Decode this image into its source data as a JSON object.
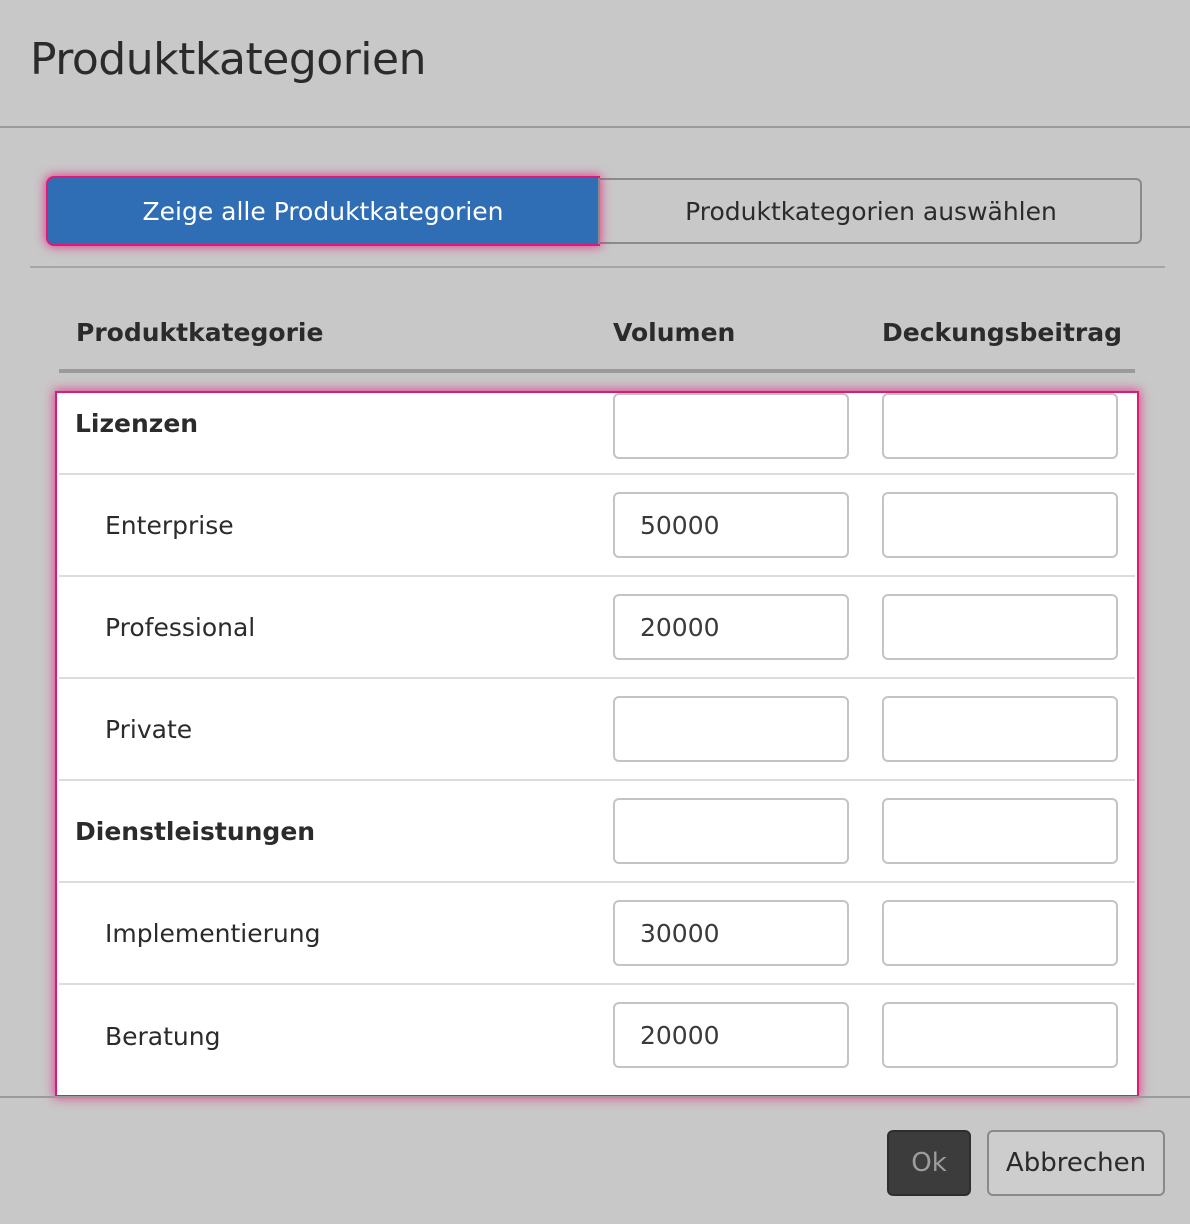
{
  "dialog": {
    "title": "Produktkategorien"
  },
  "filter": {
    "show_all_label": "Zeige alle Produktkategorien",
    "select_label": "Produktkategorien auswählen",
    "active": "show_all"
  },
  "table": {
    "columns": {
      "category": "Produktkategorie",
      "volume": "Volumen",
      "margin": "Deckungsbeitrag"
    },
    "rows": [
      {
        "label": "Lizenzen",
        "level": "group",
        "volume": "",
        "margin": ""
      },
      {
        "label": "Enterprise",
        "level": "child",
        "volume": "50000",
        "margin": ""
      },
      {
        "label": "Professional",
        "level": "child",
        "volume": "20000",
        "margin": ""
      },
      {
        "label": "Private",
        "level": "child",
        "volume": "",
        "margin": ""
      },
      {
        "label": "Dienstleistungen",
        "level": "group",
        "volume": "",
        "margin": ""
      },
      {
        "label": "Implementierung",
        "level": "child",
        "volume": "30000",
        "margin": ""
      },
      {
        "label": "Beratung",
        "level": "child",
        "volume": "20000",
        "margin": ""
      }
    ]
  },
  "footer": {
    "ok_label": "Ok",
    "cancel_label": "Abbrechen"
  },
  "colors": {
    "accent": "#2f6db5",
    "highlight": "#e6147a",
    "background": "#c8c8c8",
    "ok_button": "#3c3c3c"
  }
}
